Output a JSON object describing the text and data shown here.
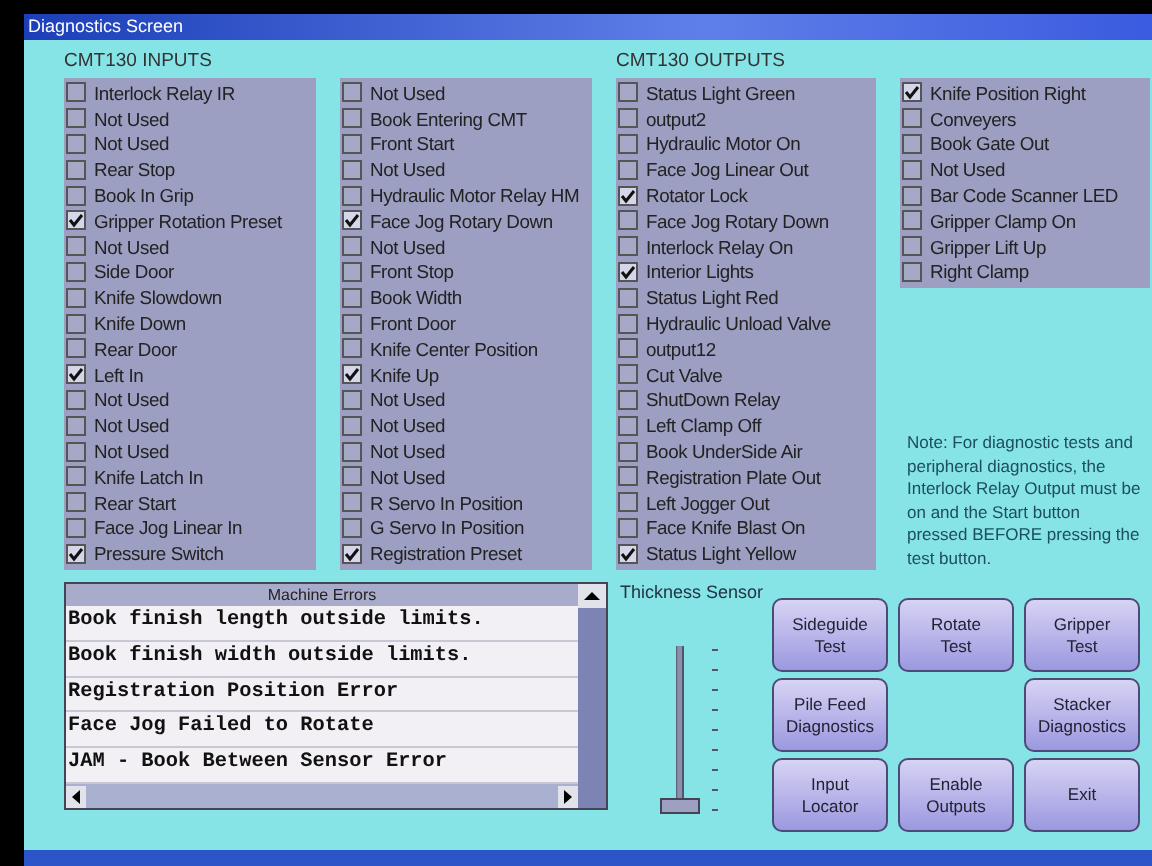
{
  "window": {
    "title": "Diagnostics Screen"
  },
  "inputs": {
    "title": "CMT130 INPUTS",
    "columns": [
      [
        {
          "label": "Interlock Relay IR",
          "checked": false
        },
        {
          "label": "Not Used",
          "checked": false
        },
        {
          "label": "Not Used",
          "checked": false
        },
        {
          "label": "Rear Stop",
          "checked": false
        },
        {
          "label": "Book In Grip",
          "checked": false
        },
        {
          "label": "Gripper Rotation Preset",
          "checked": true
        },
        {
          "label": "Not Used",
          "checked": false
        },
        {
          "label": "Side Door",
          "checked": false
        },
        {
          "label": "Knife Slowdown",
          "checked": false
        },
        {
          "label": "Knife Down",
          "checked": false
        },
        {
          "label": "Rear Door",
          "checked": false
        },
        {
          "label": "Left  In",
          "checked": true
        },
        {
          "label": "Not Used",
          "checked": false
        },
        {
          "label": "Not Used",
          "checked": false
        },
        {
          "label": "Not Used",
          "checked": false
        },
        {
          "label": "Knife Latch In",
          "checked": false
        },
        {
          "label": "Rear Start",
          "checked": false
        },
        {
          "label": "Face Jog Linear In",
          "checked": false
        },
        {
          "label": "Pressure Switch",
          "checked": true
        }
      ],
      [
        {
          "label": "Not Used",
          "checked": false
        },
        {
          "label": "Book Entering CMT",
          "checked": false
        },
        {
          "label": "Front Start",
          "checked": false
        },
        {
          "label": "Not Used",
          "checked": false
        },
        {
          "label": "Hydraulic Motor Relay HM",
          "checked": false
        },
        {
          "label": "Face Jog Rotary Down",
          "checked": true
        },
        {
          "label": "Not Used",
          "checked": false
        },
        {
          "label": "Front Stop",
          "checked": false
        },
        {
          "label": "Book Width",
          "checked": false
        },
        {
          "label": "Front Door",
          "checked": false
        },
        {
          "label": "Knife Center Position",
          "checked": false
        },
        {
          "label": "Knife Up",
          "checked": true
        },
        {
          "label": "Not Used",
          "checked": false
        },
        {
          "label": "Not Used",
          "checked": false
        },
        {
          "label": "Not Used",
          "checked": false
        },
        {
          "label": "Not Used",
          "checked": false
        },
        {
          "label": "R  Servo In Position",
          "checked": false
        },
        {
          "label": "G  Servo In Position",
          "checked": false
        },
        {
          "label": "Registration Preset",
          "checked": true
        }
      ]
    ]
  },
  "outputs": {
    "title": "CMT130 OUTPUTS",
    "columns": [
      [
        {
          "label": "Status Light Green",
          "checked": false
        },
        {
          "label": "output2",
          "checked": false
        },
        {
          "label": "Hydraulic Motor On",
          "checked": false
        },
        {
          "label": "Face Jog Linear Out",
          "checked": false
        },
        {
          "label": "Rotator Lock",
          "checked": true
        },
        {
          "label": "Face Jog Rotary Down",
          "checked": false
        },
        {
          "label": "Interlock Relay On",
          "checked": false
        },
        {
          "label": "Interior Lights",
          "checked": true
        },
        {
          "label": "Status Light Red",
          "checked": false
        },
        {
          "label": "Hydraulic Unload Valve",
          "checked": false
        },
        {
          "label": "output12",
          "checked": false
        },
        {
          "label": "Cut Valve",
          "checked": false
        },
        {
          "label": "ShutDown Relay",
          "checked": false
        },
        {
          "label": "Left Clamp Off",
          "checked": false
        },
        {
          "label": "Book UnderSide Air",
          "checked": false
        },
        {
          "label": "Registration Plate Out",
          "checked": false
        },
        {
          "label": "Left Jogger Out",
          "checked": false
        },
        {
          "label": "Face Knife Blast On",
          "checked": false
        },
        {
          "label": "Status Light Yellow",
          "checked": true
        }
      ],
      [
        {
          "label": "Knife Position Right",
          "checked": true
        },
        {
          "label": "Conveyers",
          "checked": false
        },
        {
          "label": "Book Gate Out",
          "checked": false
        },
        {
          "label": "Not Used",
          "checked": false
        },
        {
          "label": "Bar Code Scanner LED",
          "checked": false
        },
        {
          "label": "Gripper Clamp On",
          "checked": false
        },
        {
          "label": "Gripper Lift Up",
          "checked": false
        },
        {
          "label": "Right Clamp",
          "checked": false
        }
      ]
    ]
  },
  "note": "Note: For diagnostic tests and peripheral diagnostics, the Interlock Relay Output must be on and the Start button pressed BEFORE pressing the test button.",
  "errors": {
    "title": "Machine Errors",
    "rows": [
      "Book finish length outside limits.",
      "Book finish width outside limits.",
      "Registration Position Error",
      "Face Jog Failed to Rotate",
      "JAM - Book Between Sensor Error"
    ]
  },
  "thickness_sensor": {
    "label": "Thickness Sensor",
    "level": 0
  },
  "buttons": [
    [
      "Sideguide",
      "Test"
    ],
    [
      "Rotate",
      "Test"
    ],
    [
      "Gripper",
      "Test"
    ],
    [
      "Pile Feed",
      "Diagnostics"
    ],
    [
      "Stacker",
      "Diagnostics"
    ],
    [
      "Input",
      "Locator"
    ],
    [
      "Enable",
      "Outputs"
    ],
    [
      "Exit"
    ]
  ]
}
